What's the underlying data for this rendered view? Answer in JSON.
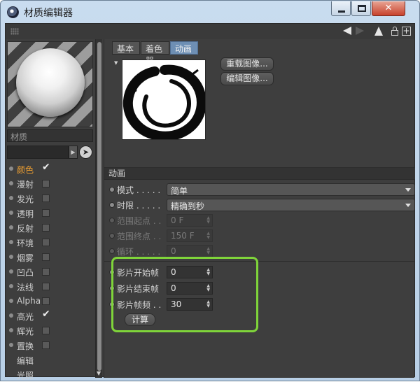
{
  "window": {
    "title": "材质编辑器",
    "buttons": {
      "minimize": "–",
      "maximize": "□",
      "close": "✕"
    }
  },
  "colors": {
    "accent_tab": "#6e8fb4",
    "active_channel": "#f0a030",
    "highlight_box": "#7fd43a",
    "panel_bg": "#3e3e3e"
  },
  "material": {
    "name_placeholder": "材质"
  },
  "channels": [
    {
      "label": "颜色",
      "state": "checked",
      "active": true
    },
    {
      "label": "漫射",
      "state": "unchecked"
    },
    {
      "label": "发光",
      "state": "unchecked"
    },
    {
      "label": "透明",
      "state": "unchecked"
    },
    {
      "label": "反射",
      "state": "unchecked"
    },
    {
      "label": "环境",
      "state": "unchecked"
    },
    {
      "label": "烟雾",
      "state": "unchecked"
    },
    {
      "label": "凹凸",
      "state": "unchecked"
    },
    {
      "label": "法线",
      "state": "unchecked"
    },
    {
      "label": "Alpha",
      "state": "unchecked"
    },
    {
      "label": "高光",
      "state": "checked"
    },
    {
      "label": "辉光",
      "state": "unchecked"
    },
    {
      "label": "置换",
      "state": "unchecked"
    },
    {
      "label": "编辑",
      "state": "none"
    },
    {
      "label": "光照",
      "state": "none"
    }
  ],
  "tabs": [
    "基本",
    "着色器",
    "动画"
  ],
  "active_tab": "动画",
  "texture_buttons": [
    "重载图像...",
    "编辑图像..."
  ],
  "section_title": "动画",
  "params": {
    "mode": {
      "label": "模式 . . . . .",
      "value": "简单"
    },
    "timing": {
      "label": "时限 . . . . .",
      "value": "精确到秒"
    },
    "range_start": {
      "label": "范围起点 . .",
      "value": "0 F"
    },
    "range_end": {
      "label": "范围终点 . .",
      "value": "150 F"
    },
    "loops": {
      "label": "循环 . . . . .",
      "value": "0"
    },
    "movie_start": {
      "label": "影片开始帧",
      "value": "0"
    },
    "movie_end": {
      "label": "影片结束帧",
      "value": "0"
    },
    "movie_fps": {
      "label": "影片帧频 . .",
      "value": "30"
    }
  },
  "calc_button": "计算",
  "icons": {
    "back": "arrow-left-icon",
    "forward": "arrow-right-icon",
    "up": "arrow-up-icon",
    "lock": "lock-icon",
    "new": "plus-icon",
    "picker": "arrow-cursor-icon",
    "check": "✔"
  }
}
